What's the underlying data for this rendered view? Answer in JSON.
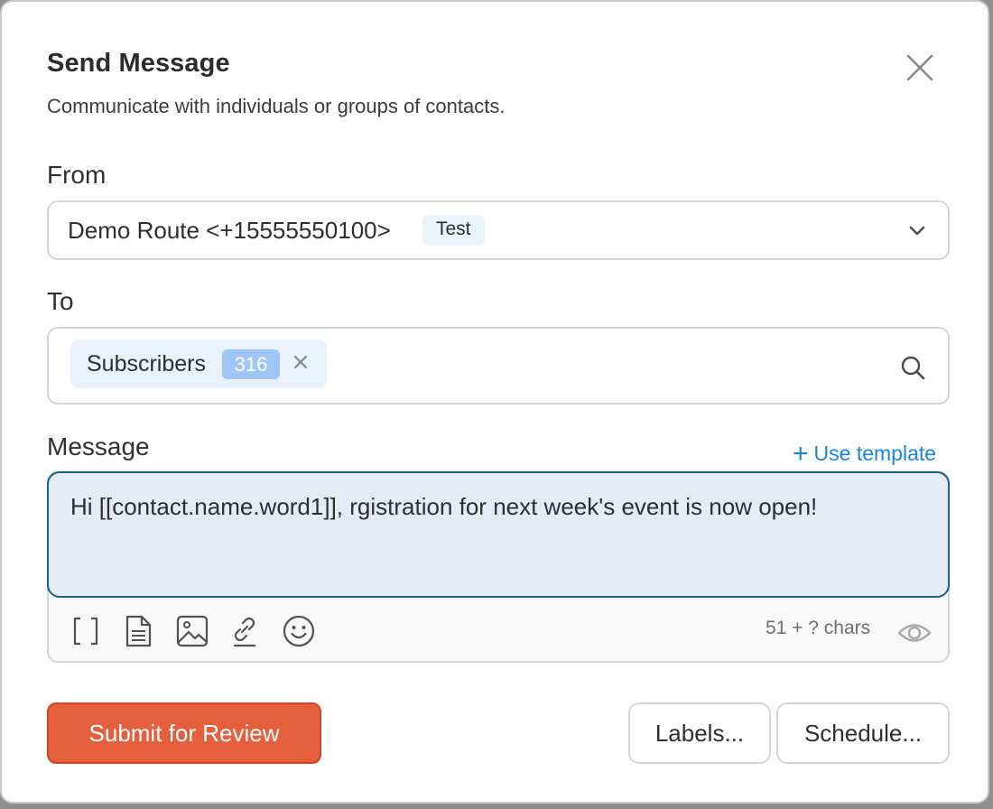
{
  "dialog": {
    "title": "Send Message",
    "subtitle": "Communicate with individuals or groups of contacts."
  },
  "from": {
    "label": "From",
    "selected_value": "Demo Route <+15555550100>",
    "badge": "Test"
  },
  "to": {
    "label": "To",
    "recipients": [
      {
        "name": "Subscribers",
        "count": "316"
      }
    ]
  },
  "message": {
    "label": "Message",
    "use_template_label": "Use template",
    "use_template_icon": "plus-icon",
    "text": "Hi [[contact.name.word1]], rgistration for next week's event is now open!",
    "char_count": "51 + ? chars",
    "toolbar_icons": [
      "brackets-icon",
      "document-icon",
      "image-icon",
      "link-icon",
      "emoji-icon",
      "eye-icon"
    ]
  },
  "actions": {
    "submit_label": "Submit for Review",
    "labels_label": "Labels...",
    "schedule_label": "Schedule..."
  },
  "colors": {
    "primary": "#e4603c",
    "link": "#1a86d9",
    "badge_bg": "#e8f3fb",
    "count_badge": "#9ec6f5",
    "message_bg": "#e4ebf4",
    "focus_border": "#1d5f8c"
  }
}
